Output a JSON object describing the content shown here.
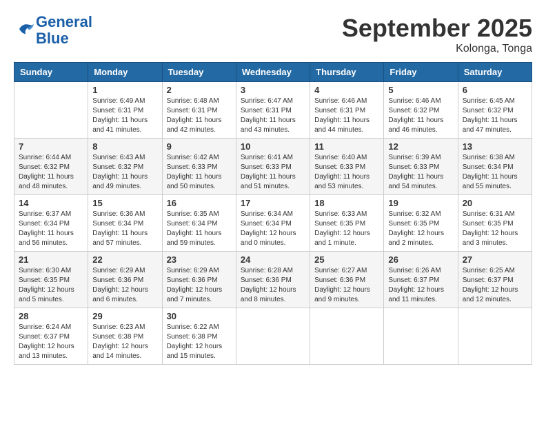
{
  "header": {
    "logo_line1": "General",
    "logo_line2": "Blue",
    "month": "September 2025",
    "location": "Kolonga, Tonga"
  },
  "weekdays": [
    "Sunday",
    "Monday",
    "Tuesday",
    "Wednesday",
    "Thursday",
    "Friday",
    "Saturday"
  ],
  "weeks": [
    [
      {
        "day": "",
        "sunrise": "",
        "sunset": "",
        "daylight": ""
      },
      {
        "day": "1",
        "sunrise": "Sunrise: 6:49 AM",
        "sunset": "Sunset: 6:31 PM",
        "daylight": "Daylight: 11 hours and 41 minutes."
      },
      {
        "day": "2",
        "sunrise": "Sunrise: 6:48 AM",
        "sunset": "Sunset: 6:31 PM",
        "daylight": "Daylight: 11 hours and 42 minutes."
      },
      {
        "day": "3",
        "sunrise": "Sunrise: 6:47 AM",
        "sunset": "Sunset: 6:31 PM",
        "daylight": "Daylight: 11 hours and 43 minutes."
      },
      {
        "day": "4",
        "sunrise": "Sunrise: 6:46 AM",
        "sunset": "Sunset: 6:31 PM",
        "daylight": "Daylight: 11 hours and 44 minutes."
      },
      {
        "day": "5",
        "sunrise": "Sunrise: 6:46 AM",
        "sunset": "Sunset: 6:32 PM",
        "daylight": "Daylight: 11 hours and 46 minutes."
      },
      {
        "day": "6",
        "sunrise": "Sunrise: 6:45 AM",
        "sunset": "Sunset: 6:32 PM",
        "daylight": "Daylight: 11 hours and 47 minutes."
      }
    ],
    [
      {
        "day": "7",
        "sunrise": "Sunrise: 6:44 AM",
        "sunset": "Sunset: 6:32 PM",
        "daylight": "Daylight: 11 hours and 48 minutes."
      },
      {
        "day": "8",
        "sunrise": "Sunrise: 6:43 AM",
        "sunset": "Sunset: 6:32 PM",
        "daylight": "Daylight: 11 hours and 49 minutes."
      },
      {
        "day": "9",
        "sunrise": "Sunrise: 6:42 AM",
        "sunset": "Sunset: 6:33 PM",
        "daylight": "Daylight: 11 hours and 50 minutes."
      },
      {
        "day": "10",
        "sunrise": "Sunrise: 6:41 AM",
        "sunset": "Sunset: 6:33 PM",
        "daylight": "Daylight: 11 hours and 51 minutes."
      },
      {
        "day": "11",
        "sunrise": "Sunrise: 6:40 AM",
        "sunset": "Sunset: 6:33 PM",
        "daylight": "Daylight: 11 hours and 53 minutes."
      },
      {
        "day": "12",
        "sunrise": "Sunrise: 6:39 AM",
        "sunset": "Sunset: 6:33 PM",
        "daylight": "Daylight: 11 hours and 54 minutes."
      },
      {
        "day": "13",
        "sunrise": "Sunrise: 6:38 AM",
        "sunset": "Sunset: 6:34 PM",
        "daylight": "Daylight: 11 hours and 55 minutes."
      }
    ],
    [
      {
        "day": "14",
        "sunrise": "Sunrise: 6:37 AM",
        "sunset": "Sunset: 6:34 PM",
        "daylight": "Daylight: 11 hours and 56 minutes."
      },
      {
        "day": "15",
        "sunrise": "Sunrise: 6:36 AM",
        "sunset": "Sunset: 6:34 PM",
        "daylight": "Daylight: 11 hours and 57 minutes."
      },
      {
        "day": "16",
        "sunrise": "Sunrise: 6:35 AM",
        "sunset": "Sunset: 6:34 PM",
        "daylight": "Daylight: 11 hours and 59 minutes."
      },
      {
        "day": "17",
        "sunrise": "Sunrise: 6:34 AM",
        "sunset": "Sunset: 6:34 PM",
        "daylight": "Daylight: 12 hours and 0 minutes."
      },
      {
        "day": "18",
        "sunrise": "Sunrise: 6:33 AM",
        "sunset": "Sunset: 6:35 PM",
        "daylight": "Daylight: 12 hours and 1 minute."
      },
      {
        "day": "19",
        "sunrise": "Sunrise: 6:32 AM",
        "sunset": "Sunset: 6:35 PM",
        "daylight": "Daylight: 12 hours and 2 minutes."
      },
      {
        "day": "20",
        "sunrise": "Sunrise: 6:31 AM",
        "sunset": "Sunset: 6:35 PM",
        "daylight": "Daylight: 12 hours and 3 minutes."
      }
    ],
    [
      {
        "day": "21",
        "sunrise": "Sunrise: 6:30 AM",
        "sunset": "Sunset: 6:35 PM",
        "daylight": "Daylight: 12 hours and 5 minutes."
      },
      {
        "day": "22",
        "sunrise": "Sunrise: 6:29 AM",
        "sunset": "Sunset: 6:36 PM",
        "daylight": "Daylight: 12 hours and 6 minutes."
      },
      {
        "day": "23",
        "sunrise": "Sunrise: 6:29 AM",
        "sunset": "Sunset: 6:36 PM",
        "daylight": "Daylight: 12 hours and 7 minutes."
      },
      {
        "day": "24",
        "sunrise": "Sunrise: 6:28 AM",
        "sunset": "Sunset: 6:36 PM",
        "daylight": "Daylight: 12 hours and 8 minutes."
      },
      {
        "day": "25",
        "sunrise": "Sunrise: 6:27 AM",
        "sunset": "Sunset: 6:36 PM",
        "daylight": "Daylight: 12 hours and 9 minutes."
      },
      {
        "day": "26",
        "sunrise": "Sunrise: 6:26 AM",
        "sunset": "Sunset: 6:37 PM",
        "daylight": "Daylight: 12 hours and 11 minutes."
      },
      {
        "day": "27",
        "sunrise": "Sunrise: 6:25 AM",
        "sunset": "Sunset: 6:37 PM",
        "daylight": "Daylight: 12 hours and 12 minutes."
      }
    ],
    [
      {
        "day": "28",
        "sunrise": "Sunrise: 6:24 AM",
        "sunset": "Sunset: 6:37 PM",
        "daylight": "Daylight: 12 hours and 13 minutes."
      },
      {
        "day": "29",
        "sunrise": "Sunrise: 6:23 AM",
        "sunset": "Sunset: 6:38 PM",
        "daylight": "Daylight: 12 hours and 14 minutes."
      },
      {
        "day": "30",
        "sunrise": "Sunrise: 6:22 AM",
        "sunset": "Sunset: 6:38 PM",
        "daylight": "Daylight: 12 hours and 15 minutes."
      },
      {
        "day": "",
        "sunrise": "",
        "sunset": "",
        "daylight": ""
      },
      {
        "day": "",
        "sunrise": "",
        "sunset": "",
        "daylight": ""
      },
      {
        "day": "",
        "sunrise": "",
        "sunset": "",
        "daylight": ""
      },
      {
        "day": "",
        "sunrise": "",
        "sunset": "",
        "daylight": ""
      }
    ]
  ]
}
